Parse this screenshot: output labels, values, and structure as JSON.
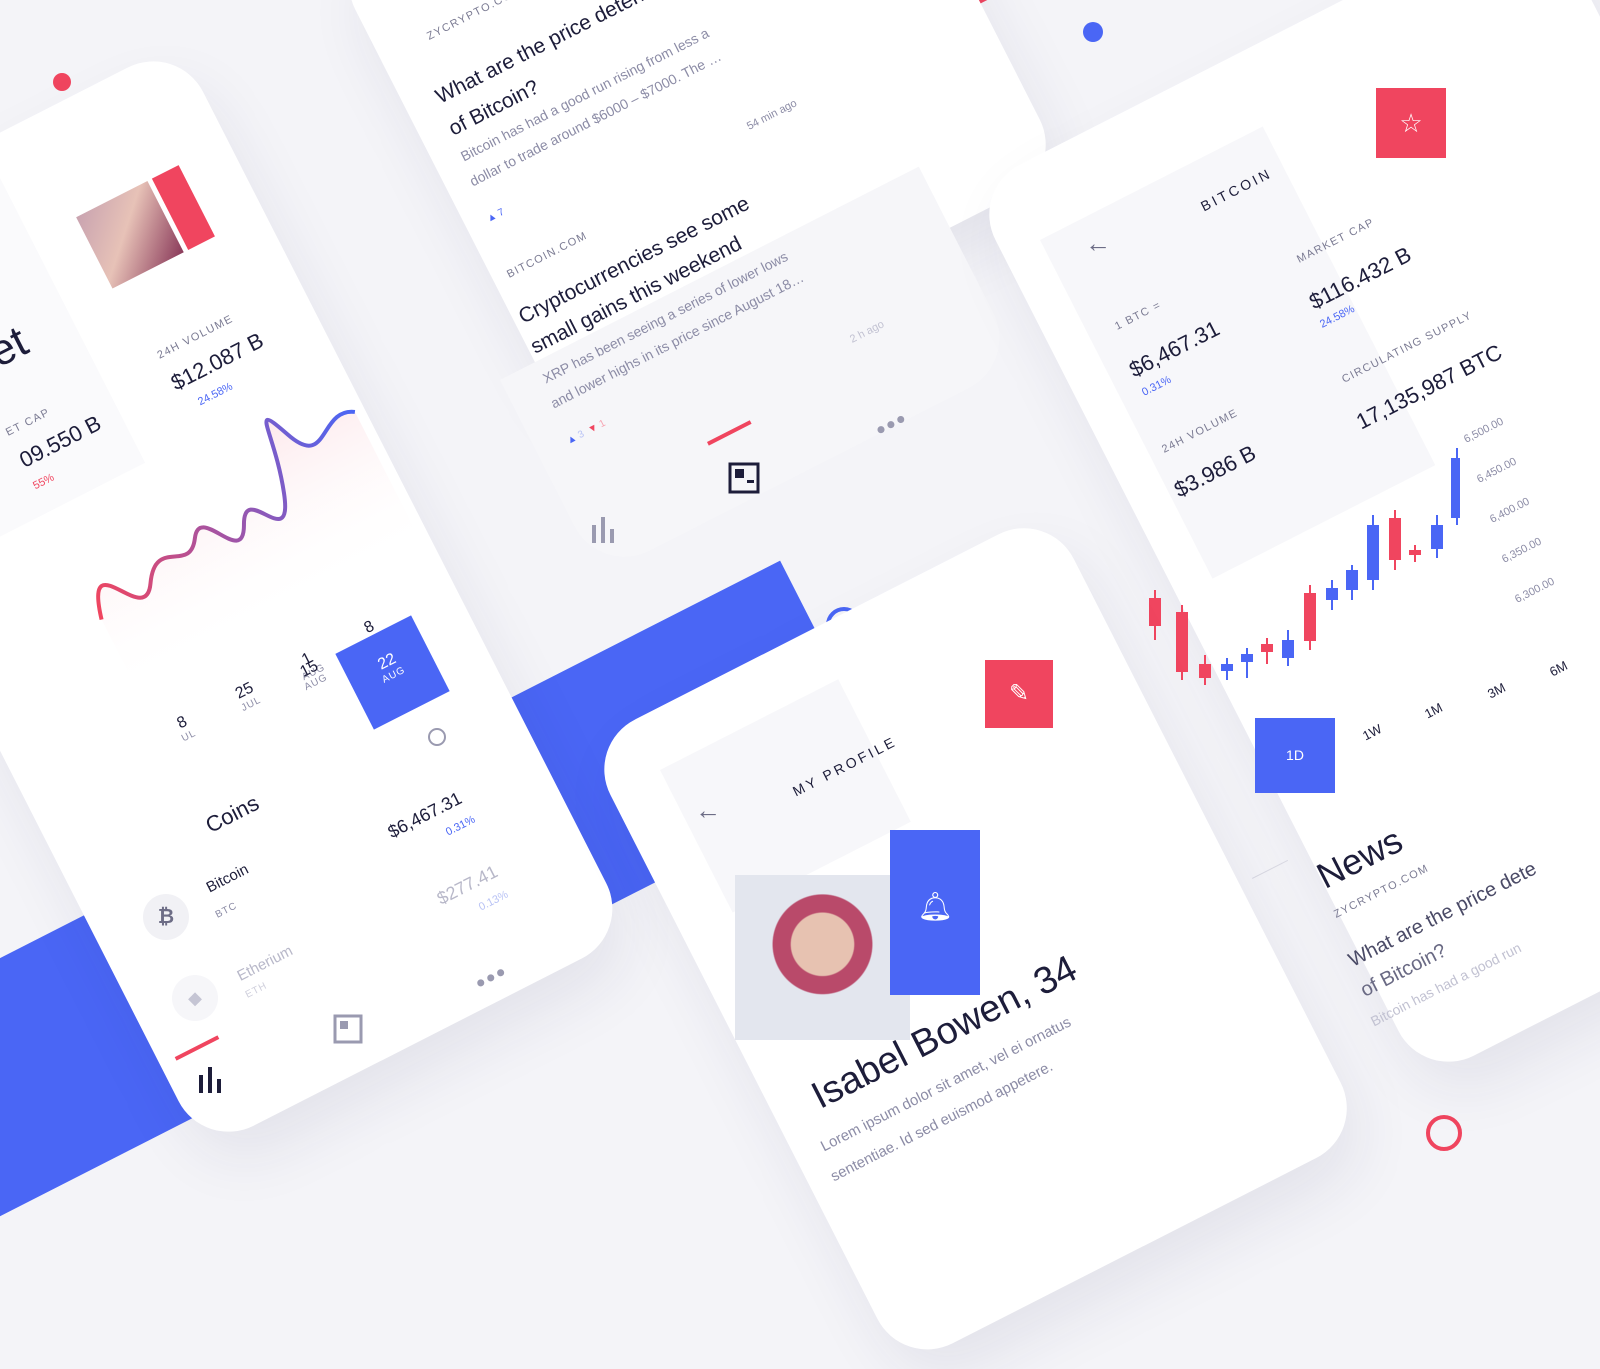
{
  "market": {
    "title_fragment": "ket",
    "market_cap_label": "ET CAP",
    "market_cap_value": "09.550 B",
    "market_cap_change": "55%",
    "volume_label": "24H VOLUME",
    "volume_value": "$12.087 B",
    "volume_change": "24.58%",
    "dates": [
      {
        "day": "8",
        "month": "UL"
      },
      {
        "day": "25",
        "month": "JUL"
      },
      {
        "day": "1",
        "month": "AUG"
      },
      {
        "day": "8",
        "month": "AUG"
      },
      {
        "day": "15",
        "month": "AUG"
      },
      {
        "day": "22",
        "month": "AUG"
      }
    ],
    "coins_heading": "Coins",
    "coins": [
      {
        "name": "Bitcoin",
        "symbol": "BTC",
        "price": "$6,467.31",
        "change": "0.31%",
        "glyph": "₿"
      },
      {
        "name": "Etherium",
        "symbol": "ETH",
        "price": "$277.41",
        "change": "0.13%",
        "glyph": "◆"
      }
    ]
  },
  "news": {
    "articles": [
      {
        "source": "ZYCRYPTO.COM",
        "title_line1": "What are the price determi",
        "title_line2": "of Bitcoin?",
        "body_line1": "Bitcoin has had a good run rising from less a",
        "body_line2": "dollar to trade around $6000 – $7000. The …",
        "time": "54 min ago",
        "up_votes": "7"
      },
      {
        "source": "BITCOIN.COM",
        "title_line1": "Cryptocurrencies see some",
        "title_line2": "small gains this weekend",
        "body_line1": "XRP has been seeing a series of lower lows",
        "body_line2": "and lower highs in its price since August 18…",
        "time": "2 h ago",
        "up_votes": "3",
        "down_votes": "1"
      }
    ]
  },
  "bitcoin": {
    "title": "BITCOIN",
    "price_label": "1 BTC =",
    "price_value": "$6,467.31",
    "price_change": "0.31%",
    "volume_label": "24H VOLUME",
    "volume_value": "$3.986 B",
    "market_cap_label": "MARKET CAP",
    "market_cap_value": "$116.432 B",
    "market_cap_change": "24.58%",
    "supply_label": "CIRCULATING SUPPLY",
    "supply_value": "17,135,987 BTC",
    "y_ticks": [
      "6,500.00",
      "6,450.00",
      "6,400.00",
      "6,350.00",
      "6,300.00"
    ],
    "ranges": [
      "1D",
      "1W",
      "1M",
      "3M",
      "6M"
    ],
    "news_heading": "News",
    "news_source": "ZYCRYPTO.COM",
    "news_title_line1": "What are the price dete",
    "news_title_line2": "of Bitcoin?",
    "news_body": "Bitcoin has had a good run"
  },
  "profile": {
    "title": "MY PROFILE",
    "name": "Isabel Bowen, 34",
    "bio_line1": "Lorem ipsum dolor sit amet, vel ei ornatus",
    "bio_line2": "sententiae. Id sed euismod appetere."
  },
  "colors": {
    "accent_red": "#f0455f",
    "accent_blue": "#4a66f5",
    "text_dark": "#1d1d3a",
    "muted": "#8c8ca6"
  }
}
